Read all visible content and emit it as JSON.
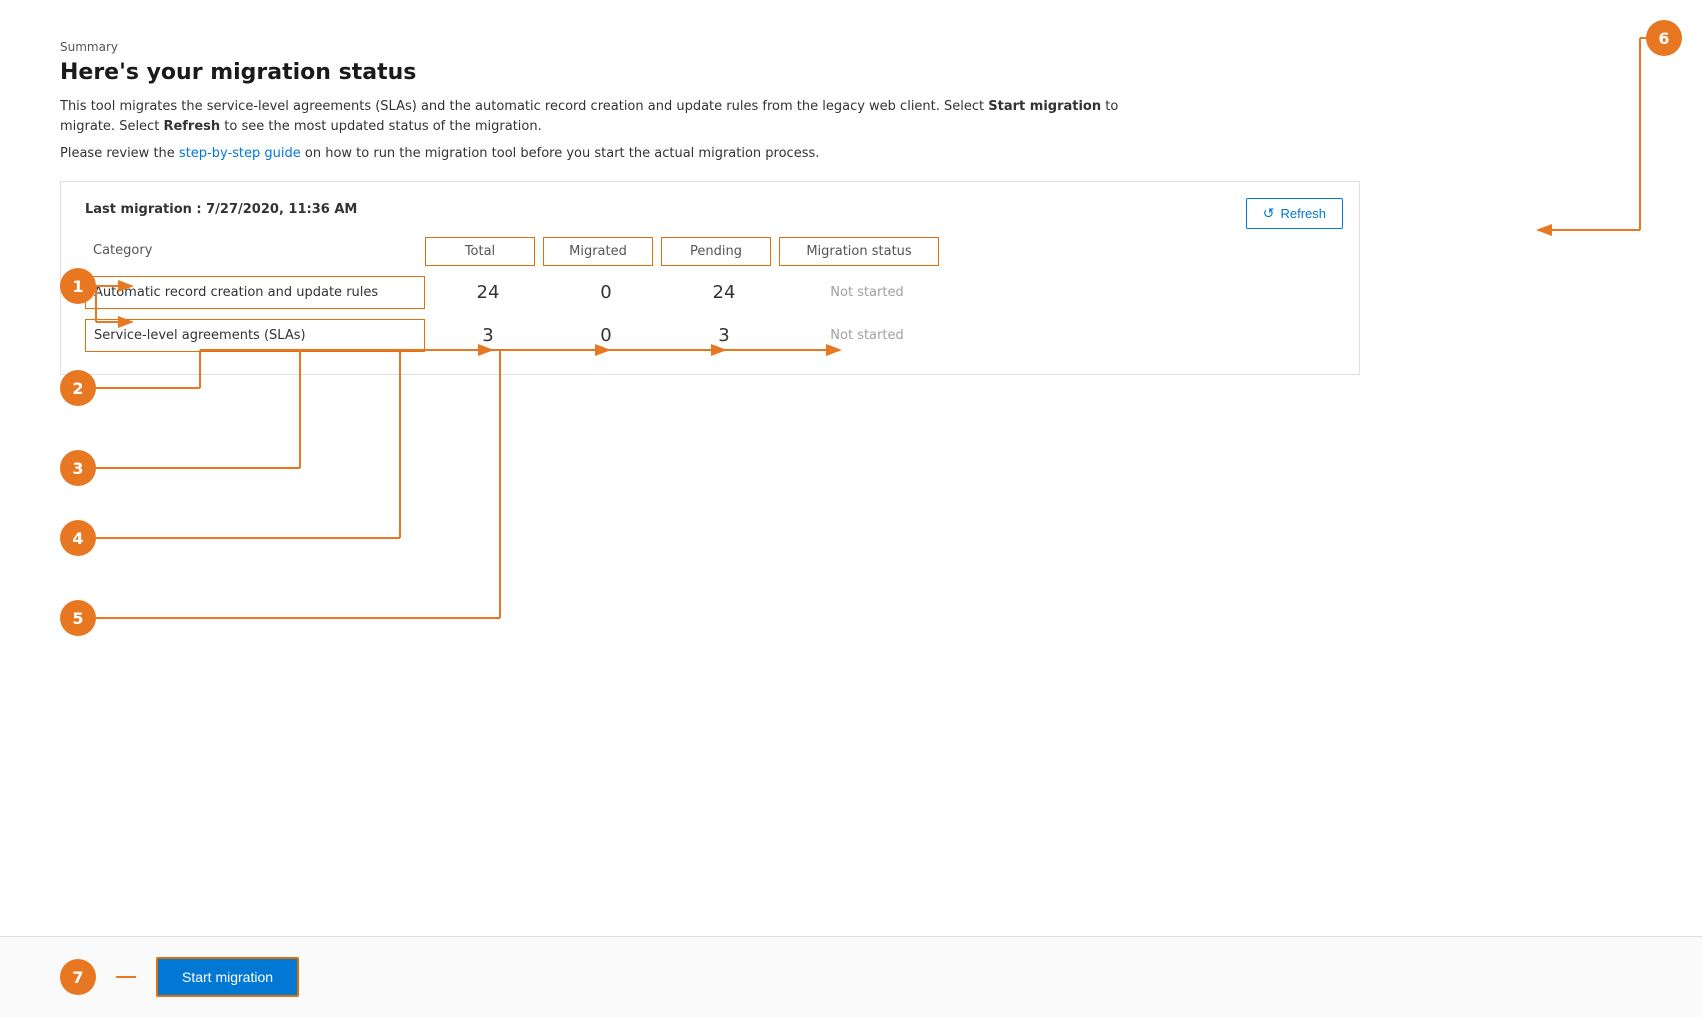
{
  "page": {
    "summary_label": "Summary",
    "title": "Here's your migration status",
    "description": "This tool migrates the service-level agreements (SLAs) and the automatic record creation and update rules from the legacy web client. Select ",
    "description_bold1": "Start migration",
    "description_mid": " to migrate. Select ",
    "description_bold2": "Refresh",
    "description_end": " to see the most updated status of the migration.",
    "guide_prefix": "Please review the ",
    "guide_link": "step-by-step guide",
    "guide_suffix": " on how to run the migration tool before you start the actual migration process.",
    "last_migration": "Last migration : 7/27/2020, 11:36 AM"
  },
  "refresh_button": {
    "label": "Refresh",
    "icon": "↺"
  },
  "table": {
    "headers": {
      "category": "Category",
      "total": "Total",
      "migrated": "Migrated",
      "pending": "Pending",
      "status": "Migration status"
    },
    "rows": [
      {
        "category": "Automatic record creation and update rules",
        "total": "24",
        "migrated": "0",
        "pending": "24",
        "status": "Not started"
      },
      {
        "category": "Service-level agreements (SLAs)",
        "total": "3",
        "migrated": "0",
        "pending": "3",
        "status": "Not started"
      }
    ]
  },
  "annotations": [
    {
      "id": "1",
      "label": "1"
    },
    {
      "id": "2",
      "label": "2"
    },
    {
      "id": "3",
      "label": "3"
    },
    {
      "id": "4",
      "label": "4"
    },
    {
      "id": "5",
      "label": "5"
    },
    {
      "id": "6",
      "label": "6"
    },
    {
      "id": "7",
      "label": "7"
    }
  ],
  "bottom_bar": {
    "start_button": "Start migration"
  },
  "colors": {
    "orange": "#e87722",
    "blue": "#0078d4"
  }
}
